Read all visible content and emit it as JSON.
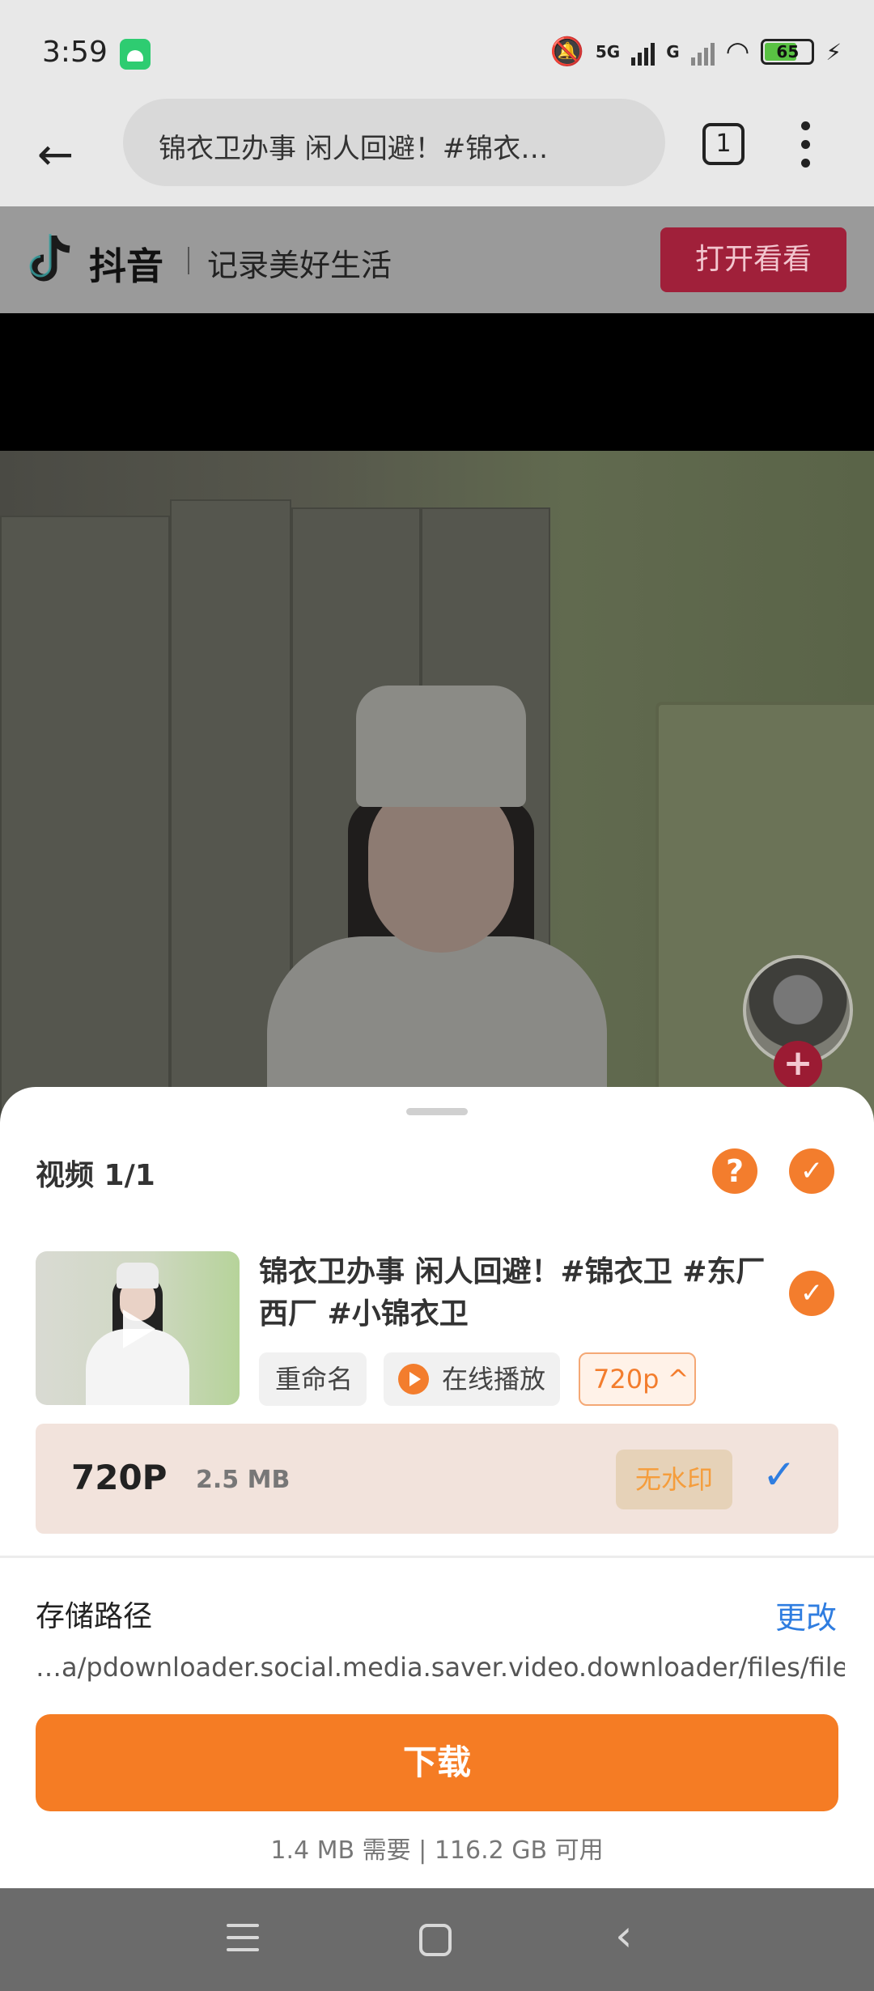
{
  "status_bar": {
    "time": "3:59",
    "network_1": "5G",
    "network_2": "G",
    "battery": "65"
  },
  "browser": {
    "url_text": "锦衣卫办事 闲人回避！#锦衣…",
    "tab_count": "1"
  },
  "douyin": {
    "brand": "抖音",
    "slogan": "记录美好生活",
    "open_button": "打开看看"
  },
  "sheet": {
    "title": "视频 1/1",
    "item": {
      "title": "锦衣卫办事 闲人回避！#锦衣卫 #东厂西厂 #小锦衣卫",
      "rename_label": "重命名",
      "play_online_label": "在线播放",
      "quality_selector": "720p ^"
    },
    "quality_option": {
      "label": "720P",
      "size": "2.5 MB",
      "badge": "无水印"
    },
    "storage": {
      "title": "存储路径",
      "change_label": "更改",
      "path": "…a/pdownloader.social.media.saver.video.downloader/files/file"
    },
    "download_label": "下载",
    "space_info": "1.4 MB 需要 | 116.2 GB 可用"
  },
  "colors": {
    "accent": "#f57c24",
    "link": "#2f7de0",
    "douyin_red": "#a0203a"
  }
}
